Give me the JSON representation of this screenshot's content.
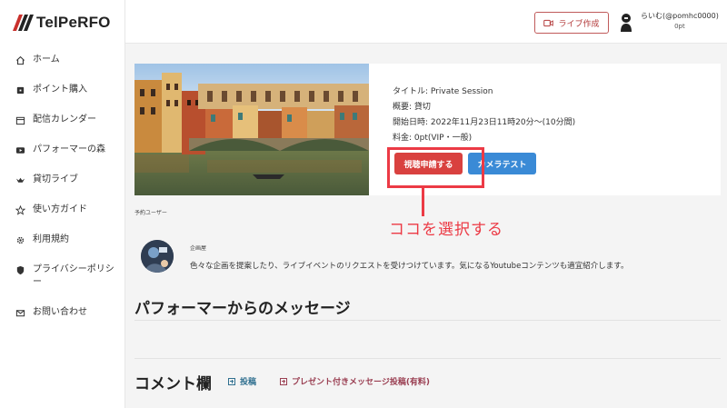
{
  "brand": {
    "logo_text": "TelPeRFO"
  },
  "sidebar": {
    "items": [
      {
        "label": "ホーム",
        "icon": "home-icon"
      },
      {
        "label": "ポイント購入",
        "icon": "wallet-icon"
      },
      {
        "label": "配信カレンダー",
        "icon": "calendar-icon"
      },
      {
        "label": "パフォーマーの森",
        "icon": "video-icon"
      },
      {
        "label": "貸切ライブ",
        "icon": "crown-icon"
      },
      {
        "label": "使い方ガイド",
        "icon": "star-icon"
      },
      {
        "label": "利用規約",
        "icon": "gear-icon"
      },
      {
        "label": "プライバシーポリシー",
        "icon": "shield-icon"
      },
      {
        "label": "お問い合わせ",
        "icon": "mail-icon"
      }
    ]
  },
  "header": {
    "create_live_label": "ライブ作成",
    "user_name": "らいむ(@pomhc0000)",
    "user_points": "0pt"
  },
  "live": {
    "title_line": "タイトル: Private Session",
    "summary_line": "概要: 貸切",
    "start_line": "開始日時: 2022年11月23日11時20分〜(10分間)",
    "fee_line": "料金: 0pt(VIP・一般)",
    "apply_button": "視聴申請する",
    "camera_button": "カメラテスト"
  },
  "annotation": {
    "text": "ココを選択する",
    "color": "#ec3a45"
  },
  "reserved_users_label": "予約ユーザー",
  "planner": {
    "role": "企画屋",
    "description": "色々な企画を提案したり、ライブイベントのリクエストを受けつけています。気になるYoutubeコンテンツも適宜紹介します。"
  },
  "sections": {
    "performer_message_title": "パフォーマーからのメッセージ",
    "comment_title": "コメント欄",
    "post_link": "投稿",
    "gift_message_link": "プレゼント付きメッセージ投稿(有料)"
  },
  "colors": {
    "accent_red": "#d9413f",
    "accent_blue": "#3a8ad6",
    "post_link": "#2f6f8f",
    "gift_link": "#9a3f52"
  }
}
